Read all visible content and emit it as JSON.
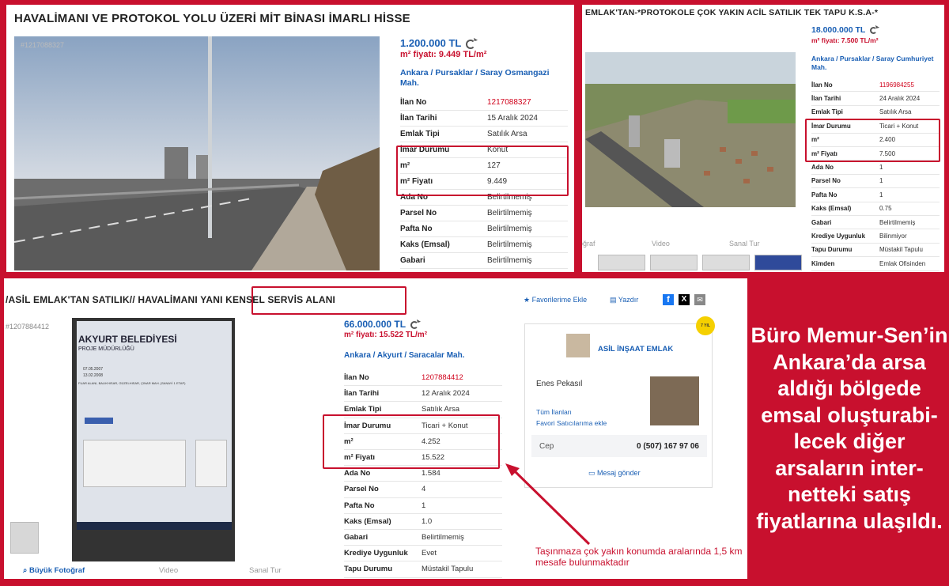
{
  "listing1": {
    "title": "HAVALİMANI VE PROTOKOL YOLU ÜZERİ MİT BİNASI İMARLI HİSSE",
    "photo_id": "#1217088327",
    "price": "1.200.000 TL",
    "ppm_label": "m² fiyatı: 9.449 TL/m²",
    "location": "Ankara  /  Pursaklar  /  Saray Osmangazi Mah.",
    "rows": [
      {
        "k": "İlan No",
        "v": "1217088327",
        "red": true
      },
      {
        "k": "İlan Tarihi",
        "v": "15 Aralık 2024"
      },
      {
        "k": "Emlak Tipi",
        "v": "Satılık Arsa"
      },
      {
        "k": "İmar Durumu",
        "v": "Konut"
      },
      {
        "k": "m²",
        "v": "127"
      },
      {
        "k": "m² Fiyatı",
        "v": "9.449"
      },
      {
        "k": "Ada No",
        "v": "Belirtilmemiş"
      },
      {
        "k": "Parsel No",
        "v": "Belirtilmemiş"
      },
      {
        "k": "Pafta No",
        "v": "Belirtilmemiş"
      },
      {
        "k": "Kaks (Emsal)",
        "v": "Belirtilmemiş"
      },
      {
        "k": "Gabari",
        "v": "Belirtilmemiş"
      }
    ]
  },
  "listing2": {
    "title": "EMLAK'TAN-*PROTOKOLE ÇOK YAKIN ACİL SATILIK TEK TAPU K.S.A-*",
    "price": "18.000.000 TL",
    "ppm_label": "m² fiyatı: 7.500 TL/m²",
    "location": "Ankara  /  Pursaklar  /  Saray Cumhuriyet Mah.",
    "rows": [
      {
        "k": "İlan No",
        "v": "1196984255",
        "red": true
      },
      {
        "k": "İlan Tarihi",
        "v": "24 Aralık 2024"
      },
      {
        "k": "Emlak Tipi",
        "v": "Satılık Arsa"
      },
      {
        "k": "İmar Durumu",
        "v": "Ticari + Konut"
      },
      {
        "k": "m²",
        "v": "2.400"
      },
      {
        "k": "m² Fiyatı",
        "v": "7.500"
      },
      {
        "k": "Ada No",
        "v": "1"
      },
      {
        "k": "Parsel No",
        "v": "1"
      },
      {
        "k": "Pafta No",
        "v": "1"
      },
      {
        "k": "Kaks (Emsal)",
        "v": "0.75"
      },
      {
        "k": "Gabari",
        "v": "Belirtilmemiş"
      },
      {
        "k": "Krediye Uygunluk",
        "v": "Bilinmiyor"
      },
      {
        "k": "Tapu Durumu",
        "v": "Müstakil Tapulu"
      },
      {
        "k": "Kimden",
        "v": "Emlak Ofisinden"
      }
    ],
    "footer": {
      "video": "Video",
      "tour": "Sanal Tur",
      "photo": "fotoğraf"
    }
  },
  "listing3": {
    "title": "/ASİL EMLAK'TAN SATILIK// HAVALİMANI YANI KENSEL SERVİS ALANI",
    "photo_id": "#1207884412",
    "fav": "Favorilerime Ekle",
    "print": "Yazdır",
    "price": "66.000.000 TL",
    "ppm_label": "m² fiyatı: 15.522 TL/m²",
    "location": "Ankara  /  Akyurt  /  Saracalar Mah.",
    "rows": [
      {
        "k": "İlan No",
        "v": "1207884412",
        "red": true
      },
      {
        "k": "İlan Tarihi",
        "v": "12 Aralık 2024"
      },
      {
        "k": "Emlak Tipi",
        "v": "Satılık Arsa"
      },
      {
        "k": "İmar Durumu",
        "v": "Ticari + Konut"
      },
      {
        "k": "m²",
        "v": "4.252"
      },
      {
        "k": "m² Fiyatı",
        "v": "15.522"
      },
      {
        "k": "Ada No",
        "v": "1.584"
      },
      {
        "k": "Parsel No",
        "v": "4"
      },
      {
        "k": "Pafta No",
        "v": "1"
      },
      {
        "k": "Kaks (Emsal)",
        "v": "1.0"
      },
      {
        "k": "Gabari",
        "v": "Belirtilmemiş"
      },
      {
        "k": "Krediye Uygunluk",
        "v": "Evet"
      },
      {
        "k": "Tapu Durumu",
        "v": "Müstakil Tapulu"
      }
    ],
    "screen": {
      "header": "AKYURT BELEDİYESİ",
      "sub": "PROJE MÜDÜRLÜĞÜ",
      "d1": "07.05.2007",
      "d2": "13.02.2008",
      "loc": "FUAR ALANI, BALIKHISAR, GÜZELHISAR, ÇINAR MAH. (SANAYİ 1 ETAP)"
    },
    "agent": {
      "company": "ASİL İNŞAAT EMLAK",
      "person": "Enes Pekasıl",
      "all": "Tüm İlanları",
      "fav": "Favori Satıcılarıma ekle",
      "phone_label": "Cep",
      "phone": "0 (507) 167 97 06",
      "message": "Mesaj gönder",
      "badge": "7 YIL"
    },
    "footer": {
      "photo": "Büyük Fotoğraf",
      "video": "Video",
      "tour": "Sanal Tur"
    },
    "note": "Taşınmaza çok yakın konumda aralarında 1,5 km mesafe bulunmaktadır"
  },
  "caption": "Büro Memur-Sen’in Ankara’da arsa aldığı bölgede emsal oluşturabi-lecek diğer arsaların inter-netteki satış fiyatlarına ulaşıldı."
}
